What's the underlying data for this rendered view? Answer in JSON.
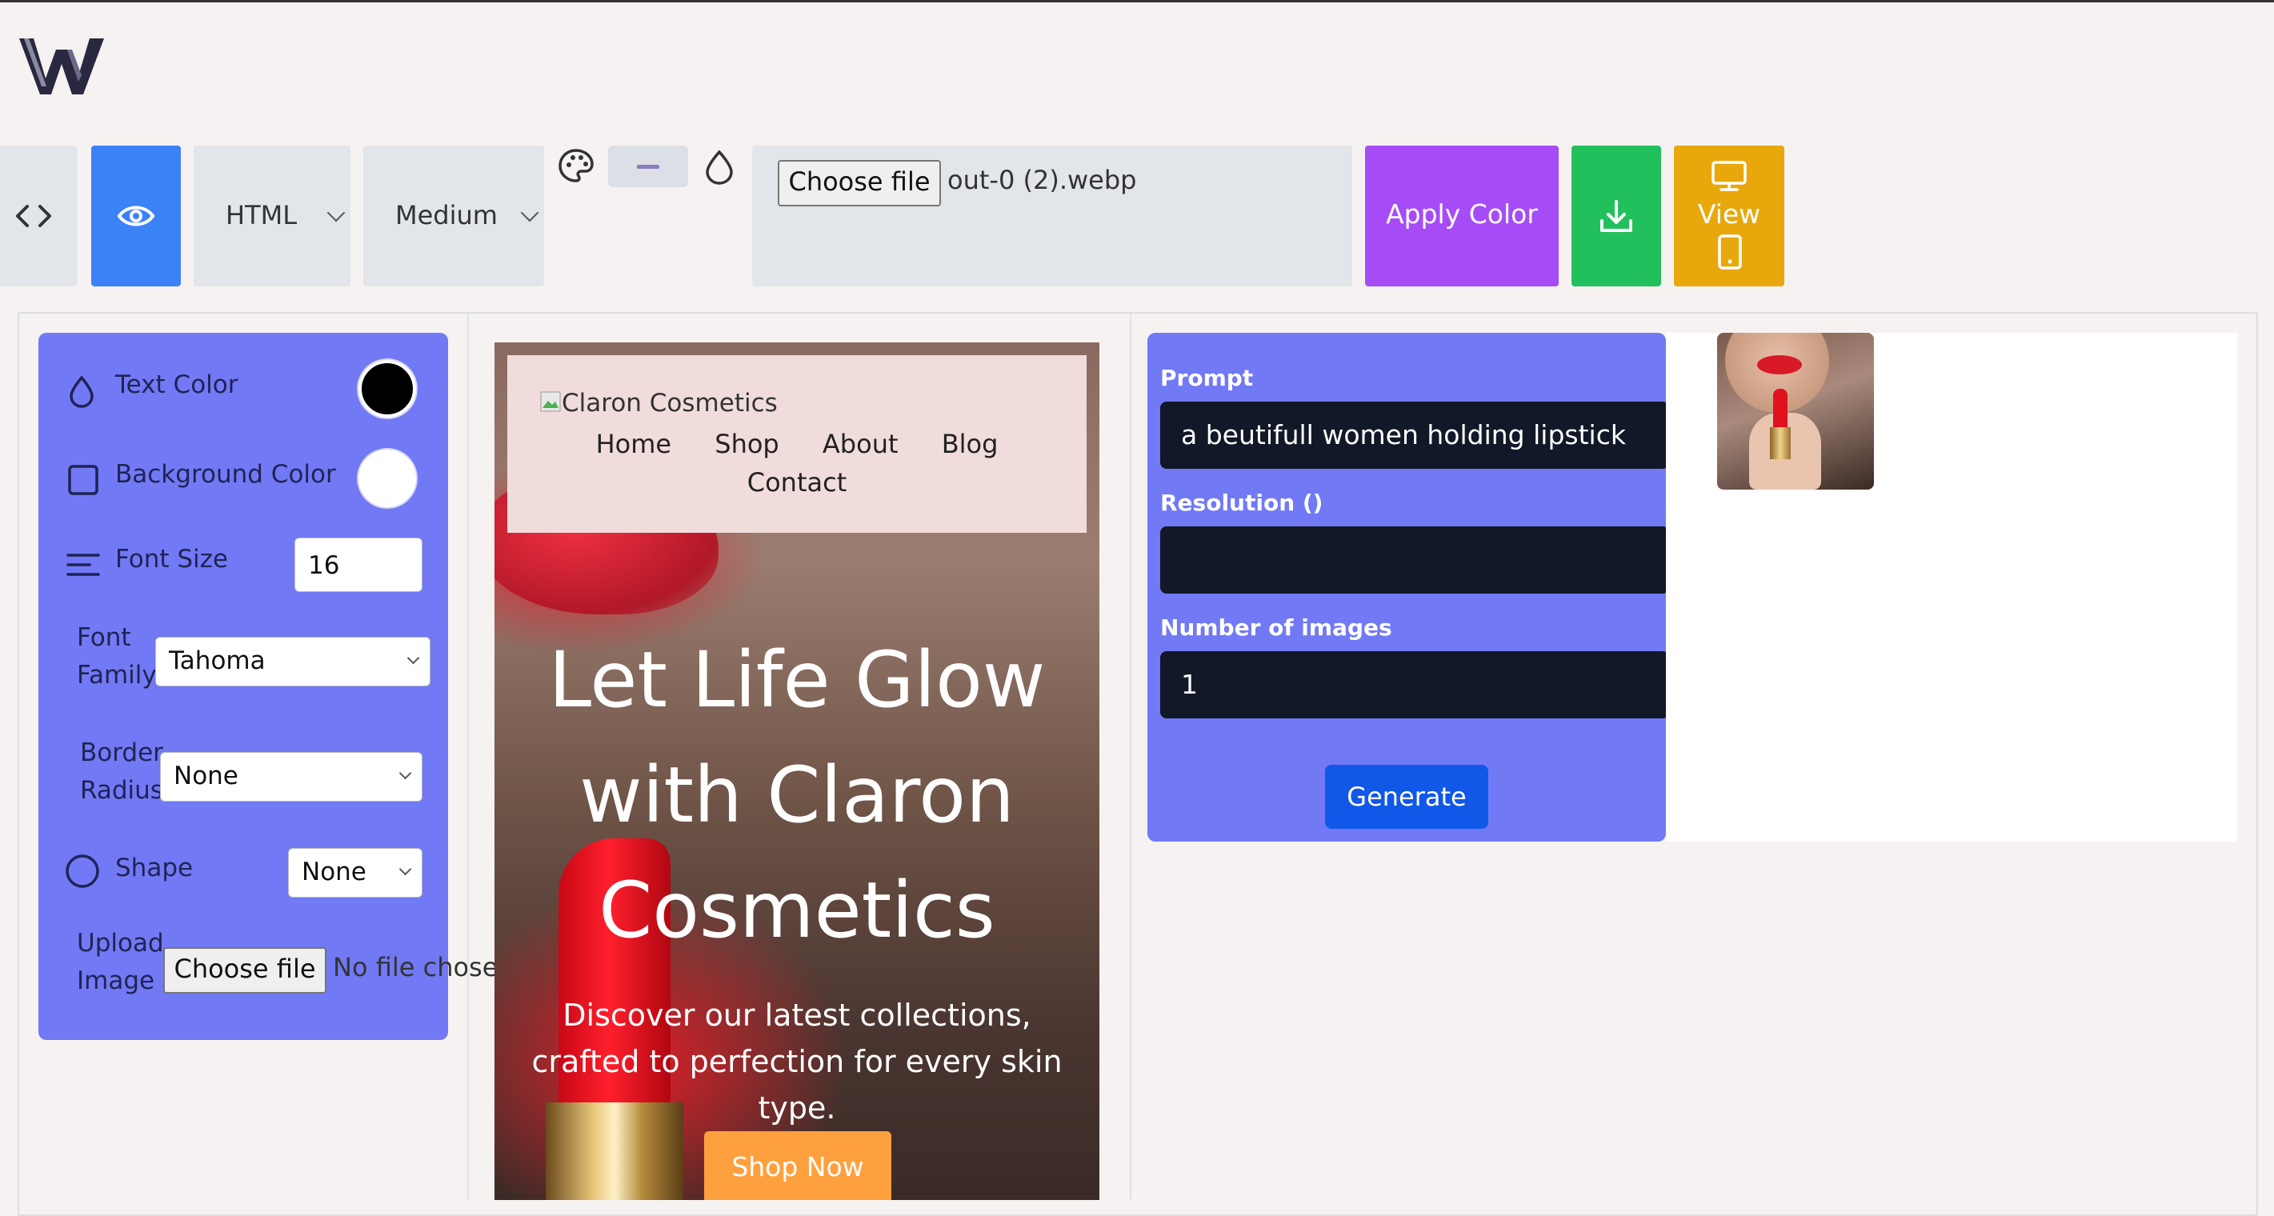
{
  "toolbar": {
    "language": "HTML",
    "size": "Medium",
    "file_button": "Choose file",
    "file_name": "out-0 (2).webp",
    "apply_color": "Apply Color",
    "view": "View"
  },
  "style_panel": {
    "text_color_label": "Text Color",
    "background_color_label": "Background Color",
    "font_size_label": "Font Size",
    "font_size_value": "16",
    "font_family_label_1": "Font",
    "font_family_label_2": "Family",
    "font_family_value": "Tahoma",
    "border_radius_label_1": "Border",
    "border_radius_label_2": "Radius",
    "border_radius_value": "None",
    "shape_label": "Shape",
    "shape_value": "None",
    "upload_label_1": "Upload",
    "upload_label_2": "Image",
    "upload_button": "Choose file",
    "upload_status": "No file chosen",
    "text_color": "#000000",
    "background_color": "#ffffff"
  },
  "preview": {
    "logo_alt": "Claron Cosmetics",
    "nav": [
      "Home",
      "Shop",
      "About",
      "Blog",
      "Contact"
    ],
    "hero_line1": "Let Life Glow",
    "hero_line2": "with Claron",
    "hero_line3": "Cosmetics",
    "sub_line1": "Discover our latest collections,",
    "sub_line2": "crafted to perfection for every skin",
    "sub_line3": "type.",
    "cta": "Shop Now"
  },
  "generator": {
    "prompt_label": "Prompt",
    "prompt_value": "a beutifull women holding lipstick",
    "resolution_label": "Resolution ()",
    "resolution_value": "",
    "count_label": "Number of images",
    "count_value": "1",
    "generate": "Generate"
  },
  "colors": {
    "primary_blue": "#3b82f6",
    "purple": "#a64cf7",
    "green": "#22c05c",
    "amber": "#e8a80c",
    "panel": "#7179f4",
    "generate_blue": "#1158e8",
    "cta_orange": "#ffa03e"
  }
}
